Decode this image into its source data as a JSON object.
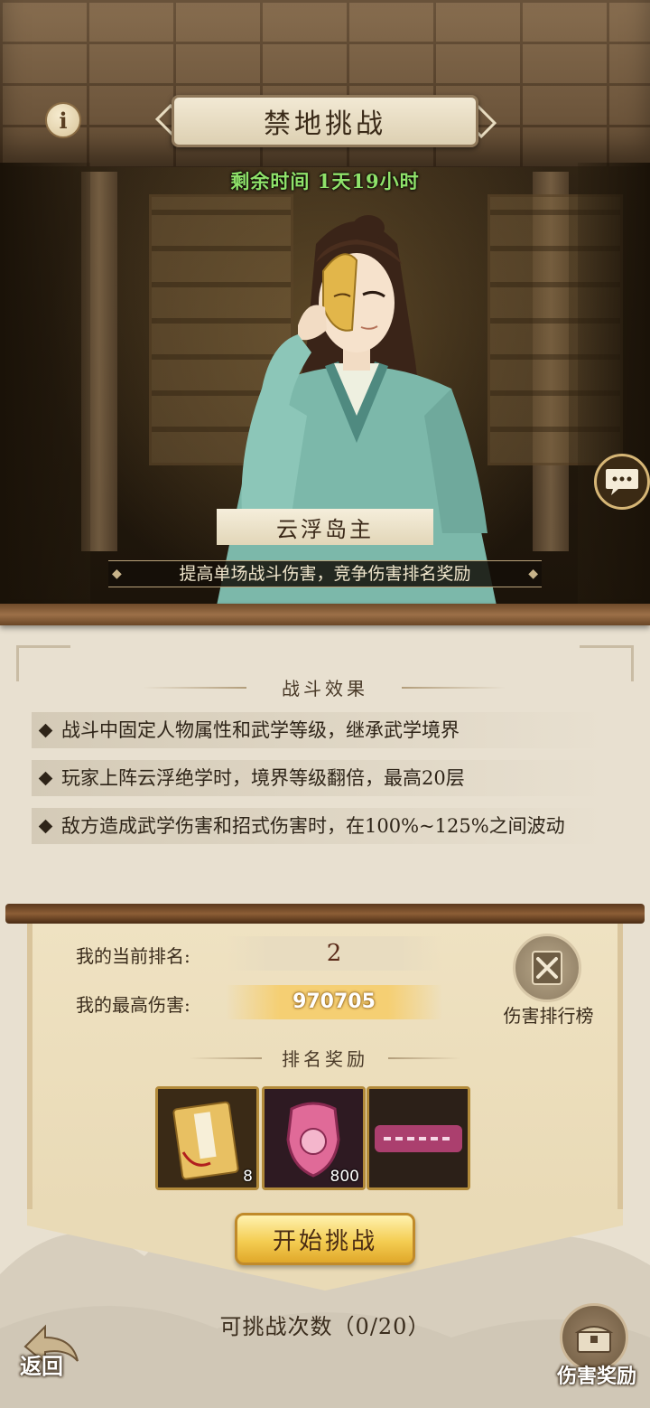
{
  "header": {
    "title": "禁地挑战",
    "timer": "剩余时间 1天19小时",
    "info_icon": "info-icon",
    "chat_icon": "chat-bubble-icon"
  },
  "boss": {
    "name": "云浮岛主",
    "description": "提高单场战斗伤害，竞争伤害排名奖励"
  },
  "effects": {
    "title": "战斗效果",
    "items": [
      "战斗中固定人物属性和武学等级，继承武学境界",
      "玩家上阵云浮绝学时，境界等级翻倍，最高20层",
      "敌方造成武学伤害和招式伤害时，在100%~125%之间波动"
    ]
  },
  "ranking": {
    "current_rank_label": "我的当前排名:",
    "current_rank": "2",
    "best_damage_label": "我的最高伤害:",
    "best_damage": "970705",
    "leaderboard_label": "伤害排行榜",
    "rewards_title": "排名奖励",
    "rewards": [
      {
        "icon": "scroll-book-icon",
        "count": "8"
      },
      {
        "icon": "pink-armor-icon",
        "count": "800"
      },
      {
        "icon": "title-badge-icon",
        "count": ""
      }
    ],
    "start_button": "开始挑战"
  },
  "footer": {
    "attempts": "可挑战次数（0/20）",
    "back_label": "返回",
    "damage_reward_label": "伤害奖励"
  },
  "colors": {
    "timer": "#8fe26a",
    "damage_gold": "#f5cf73",
    "start_button": "#f4cd52"
  }
}
